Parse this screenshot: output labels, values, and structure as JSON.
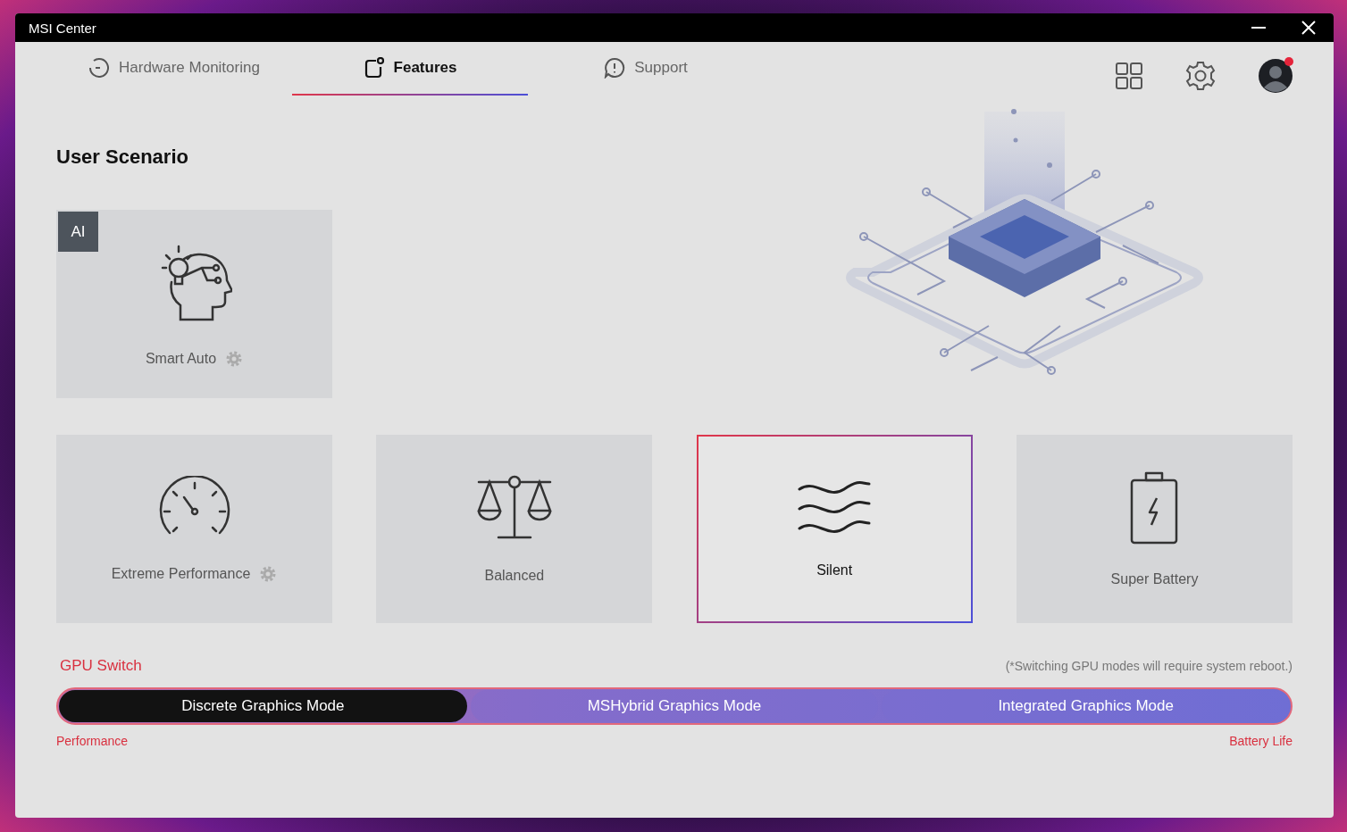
{
  "window": {
    "title": "MSI Center"
  },
  "tabs": [
    {
      "label": "Hardware Monitoring",
      "kind": "monitor",
      "selected": false
    },
    {
      "label": "Features",
      "kind": "features",
      "selected": true
    },
    {
      "label": "Support",
      "kind": "support",
      "selected": false
    }
  ],
  "profile": {
    "notification": true
  },
  "section_title": "User Scenario",
  "ai_scenario": {
    "badge": "AI",
    "label": "Smart Auto",
    "kind": "head",
    "selected": false,
    "has_settings": true
  },
  "scenarios": [
    {
      "label": "Extreme Performance",
      "kind": "gauge",
      "selected": false,
      "has_settings": true
    },
    {
      "label": "Balanced",
      "kind": "scale",
      "selected": false,
      "has_settings": false
    },
    {
      "label": "Silent",
      "kind": "waves",
      "selected": true,
      "has_settings": false
    },
    {
      "label": "Super Battery",
      "kind": "battery",
      "selected": false,
      "has_settings": false
    }
  ],
  "gpu_switch": {
    "title": "GPU Switch",
    "note": "(*Switching GPU modes will require system reboot.)",
    "modes": [
      {
        "label": "Discrete Graphics Mode",
        "selected": true
      },
      {
        "label": "MSHybrid Graphics Mode",
        "selected": false
      },
      {
        "label": "Integrated Graphics Mode",
        "selected": false
      }
    ],
    "left_label": "Performance",
    "right_label": "Battery Life"
  }
}
